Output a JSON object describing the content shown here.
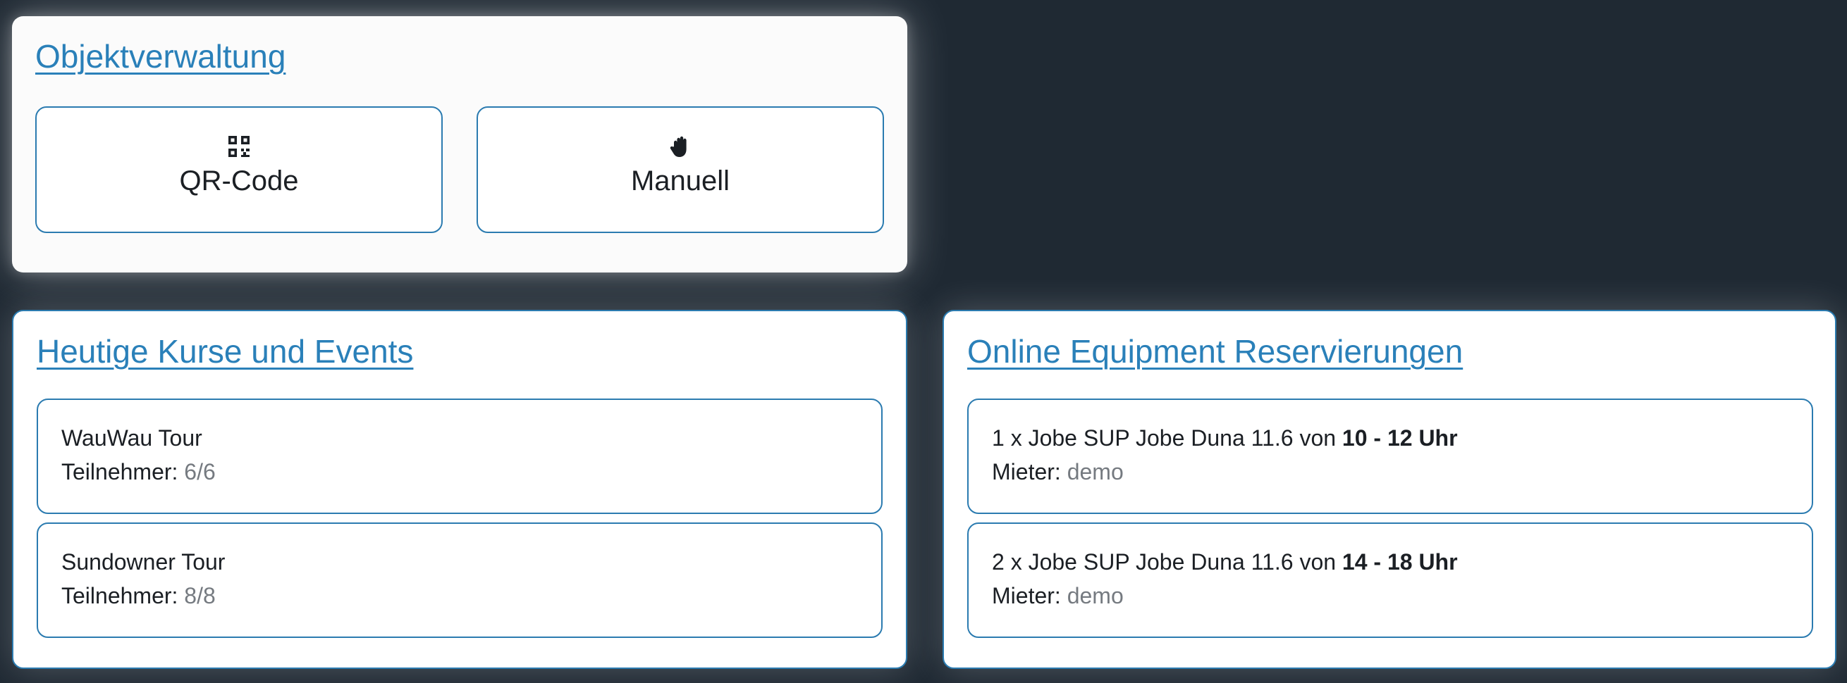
{
  "object_management": {
    "title": "Objektverwaltung",
    "qr_button": {
      "label": "QR-Code",
      "icon": "qr-code-icon"
    },
    "manual_button": {
      "label": "Manuell",
      "icon": "hand-icon"
    }
  },
  "courses": {
    "title": "Heutige Kurse und Events",
    "participants_label": "Teilnehmer:",
    "items": [
      {
        "name": "WauWau Tour",
        "participants": "6/6"
      },
      {
        "name": "Sundowner Tour",
        "participants": "8/8"
      }
    ]
  },
  "reservations": {
    "title": "Online Equipment Reservierungen",
    "renter_label": "Mieter:",
    "items": [
      {
        "description": "1 x Jobe SUP Jobe Duna 11.6 von",
        "time": "10 - 12 Uhr",
        "renter": "demo"
      },
      {
        "description": "2 x Jobe SUP Jobe Duna 11.6 von",
        "time": "14 - 18 Uhr",
        "renter": "demo"
      }
    ]
  },
  "colors": {
    "background": "#1f2933",
    "accent": "#2a80b9",
    "border": "#2b7bb0",
    "muted_text": "#757a80"
  }
}
